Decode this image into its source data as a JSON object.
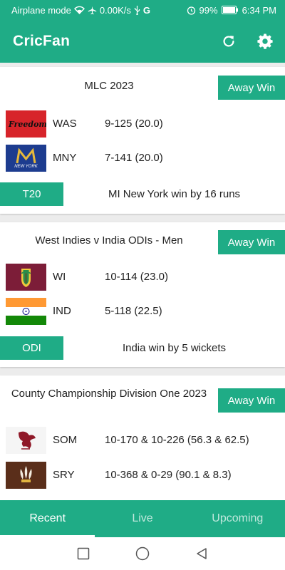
{
  "status_bar": {
    "mode_text": "Airplane mode",
    "speed": "0.00K/s",
    "network_letter": "G",
    "battery": "99%",
    "time": "6:34 PM"
  },
  "app_bar": {
    "title": "CricFan",
    "refresh_icon": "refresh-icon",
    "settings_icon": "gear-icon"
  },
  "matches": [
    {
      "title": "MLC 2023",
      "result_badge": "Away Win",
      "teams": [
        {
          "code": "WAS",
          "score": "9-125 (20.0)",
          "flag_text": "Freedom"
        },
        {
          "code": "MNY",
          "score": "7-141 (20.0)",
          "flag_text": "NEW YORK"
        }
      ],
      "format": "T20",
      "summary": "MI New York win by 16 runs"
    },
    {
      "title": "West Indies v India ODIs - Men",
      "result_badge": "Away Win",
      "teams": [
        {
          "code": "WI",
          "score": "10-114 (23.0)"
        },
        {
          "code": "IND",
          "score": "5-118 (22.5)"
        }
      ],
      "format": "ODI",
      "summary": "India win by 5 wickets"
    },
    {
      "title": "County Championship Division One 2023",
      "result_badge": "Away Win",
      "teams": [
        {
          "code": "SOM",
          "score": "10-170 & 10-226 (56.3 & 62.5)"
        },
        {
          "code": "SRY",
          "score": "10-368 & 0-29 (90.1 & 8.3)"
        }
      ]
    }
  ],
  "bottom_nav": {
    "tabs": [
      "Recent",
      "Live",
      "Upcoming"
    ],
    "active": "Recent"
  },
  "colors": {
    "accent": "#1fac86",
    "card_bg": "#ffffff",
    "page_bg": "#ececec"
  }
}
